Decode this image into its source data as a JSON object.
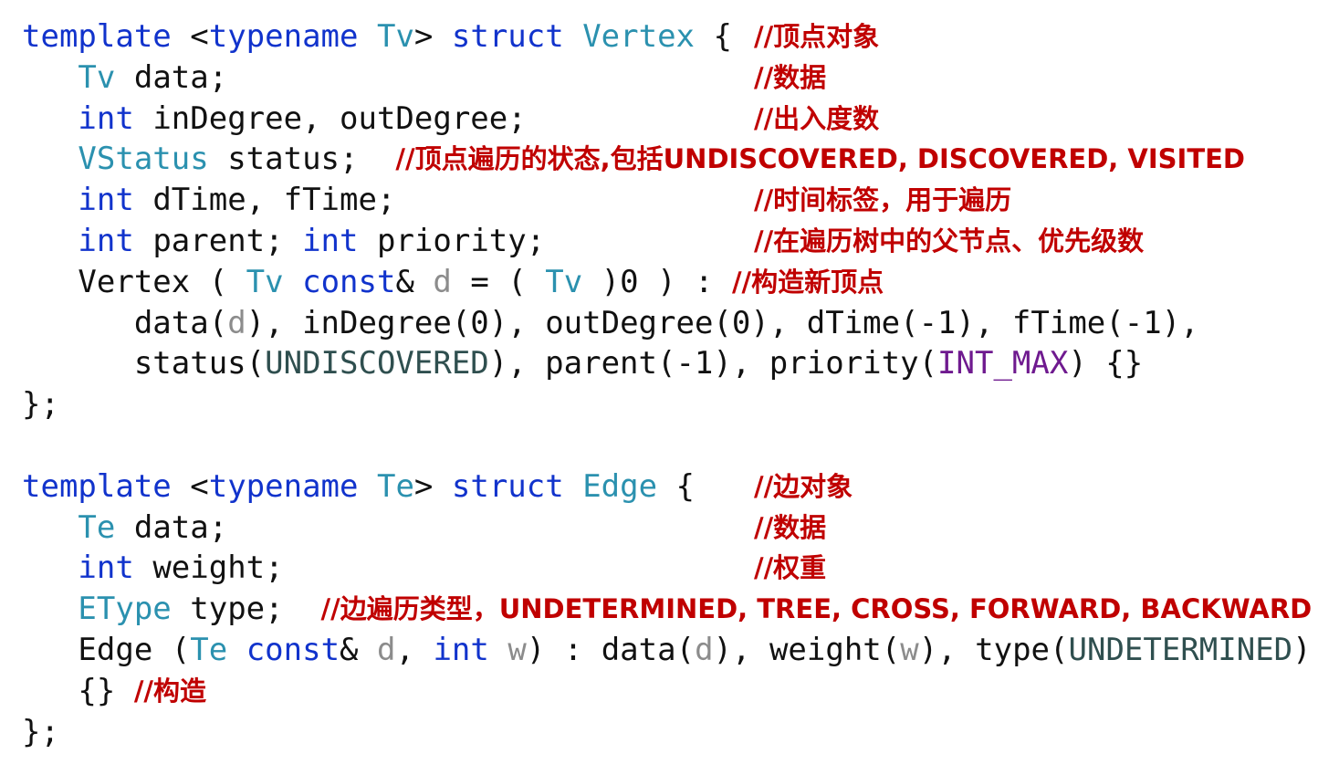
{
  "lines": [
    {
      "indent": 0,
      "tokens": [
        {
          "t": "template",
          "k": "kw"
        },
        {
          "t": " <",
          "k": "tx"
        },
        {
          "t": "typename",
          "k": "kw"
        },
        {
          "t": " ",
          "k": "tx"
        },
        {
          "t": "Tv",
          "k": "ty"
        },
        {
          "t": "> ",
          "k": "tx"
        },
        {
          "t": "struct",
          "k": "kw"
        },
        {
          "t": " ",
          "k": "tx"
        },
        {
          "t": "Vertex",
          "k": "ty"
        },
        {
          "t": " { ",
          "k": "tx"
        }
      ],
      "comment": "//顶点对象",
      "comment_col": "right"
    },
    {
      "indent": 1,
      "tokens": [
        {
          "t": "Tv",
          "k": "ty"
        },
        {
          "t": " data;",
          "k": "tx"
        }
      ],
      "comment": "//数据",
      "comment_col": "right"
    },
    {
      "indent": 1,
      "tokens": [
        {
          "t": "int",
          "k": "kw"
        },
        {
          "t": " inDegree, outDegree;",
          "k": "tx"
        }
      ],
      "comment": "//出入度数",
      "comment_col": "right"
    },
    {
      "indent": 1,
      "tokens": [
        {
          "t": "VStatus",
          "k": "ty"
        },
        {
          "t": " status;  ",
          "k": "tx"
        }
      ],
      "comment": "//顶点遍历的状态,包括UNDISCOVERED, DISCOVERED, VISITED",
      "comment_col": "inline"
    },
    {
      "indent": 1,
      "tokens": [
        {
          "t": "int",
          "k": "kw"
        },
        {
          "t": " dTime, fTime;",
          "k": "tx"
        }
      ],
      "comment": "//时间标签，用于遍历",
      "comment_col": "right"
    },
    {
      "indent": 1,
      "tokens": [
        {
          "t": "int",
          "k": "kw"
        },
        {
          "t": " parent; ",
          "k": "tx"
        },
        {
          "t": "int",
          "k": "kw"
        },
        {
          "t": " priority;",
          "k": "tx"
        }
      ],
      "comment": "//在遍历树中的父节点、优先级数",
      "comment_col": "right"
    },
    {
      "indent": 1,
      "tokens": [
        {
          "t": "Vertex ( ",
          "k": "tx"
        },
        {
          "t": "Tv",
          "k": "ty"
        },
        {
          "t": " ",
          "k": "tx"
        },
        {
          "t": "const",
          "k": "kw"
        },
        {
          "t": "& ",
          "k": "tx"
        },
        {
          "t": "d",
          "k": "pm"
        },
        {
          "t": " = ( ",
          "k": "tx"
        },
        {
          "t": "Tv",
          "k": "ty"
        },
        {
          "t": " )0 ) : ",
          "k": "tx"
        }
      ],
      "comment": "//构造新顶点",
      "comment_col": "inline"
    },
    {
      "indent": 2,
      "tokens": [
        {
          "t": "data(",
          "k": "tx"
        },
        {
          "t": "d",
          "k": "pm"
        },
        {
          "t": "), inDegree(0), outDegree(0), dTime(-1), fTime(-1),",
          "k": "tx"
        }
      ],
      "comment": "",
      "comment_col": "none"
    },
    {
      "indent": 2,
      "tokens": [
        {
          "t": "status(",
          "k": "tx"
        },
        {
          "t": "UNDISCOVERED",
          "k": "en"
        },
        {
          "t": "), parent(-1), priority(",
          "k": "tx"
        },
        {
          "t": "INT_MAX",
          "k": "mc"
        },
        {
          "t": ") {}",
          "k": "tx"
        }
      ],
      "comment": "",
      "comment_col": "none"
    },
    {
      "indent": 0,
      "tokens": [
        {
          "t": "};",
          "k": "tx"
        }
      ],
      "comment": "",
      "comment_col": "none"
    },
    {
      "indent": 0,
      "tokens": [],
      "comment": "",
      "comment_col": "none"
    },
    {
      "indent": 0,
      "tokens": [
        {
          "t": "template",
          "k": "kw"
        },
        {
          "t": " <",
          "k": "tx"
        },
        {
          "t": "typename",
          "k": "kw"
        },
        {
          "t": " ",
          "k": "tx"
        },
        {
          "t": "Te",
          "k": "ty"
        },
        {
          "t": "> ",
          "k": "tx"
        },
        {
          "t": "struct",
          "k": "kw"
        },
        {
          "t": " ",
          "k": "tx"
        },
        {
          "t": "Edge",
          "k": "ty"
        },
        {
          "t": " {",
          "k": "tx"
        }
      ],
      "comment": "//边对象",
      "comment_col": "right"
    },
    {
      "indent": 1,
      "tokens": [
        {
          "t": "Te",
          "k": "ty"
        },
        {
          "t": " data;",
          "k": "tx"
        }
      ],
      "comment": "//数据",
      "comment_col": "right"
    },
    {
      "indent": 1,
      "tokens": [
        {
          "t": "int",
          "k": "kw"
        },
        {
          "t": " weight;",
          "k": "tx"
        }
      ],
      "comment": "//权重",
      "comment_col": "right"
    },
    {
      "indent": 1,
      "tokens": [
        {
          "t": "EType",
          "k": "ty"
        },
        {
          "t": " type;  ",
          "k": "tx"
        }
      ],
      "comment": "//边遍历类型，UNDETERMINED, TREE, CROSS, FORWARD, BACKWARD",
      "comment_col": "inline"
    },
    {
      "indent": 1,
      "tokens": [
        {
          "t": "Edge (",
          "k": "tx"
        },
        {
          "t": "Te",
          "k": "ty"
        },
        {
          "t": " ",
          "k": "tx"
        },
        {
          "t": "const",
          "k": "kw"
        },
        {
          "t": "& ",
          "k": "tx"
        },
        {
          "t": "d",
          "k": "pm"
        },
        {
          "t": ", ",
          "k": "tx"
        },
        {
          "t": "int",
          "k": "kw"
        },
        {
          "t": " ",
          "k": "tx"
        },
        {
          "t": "w",
          "k": "pm"
        },
        {
          "t": ") : data(",
          "k": "tx"
        },
        {
          "t": "d",
          "k": "pm"
        },
        {
          "t": "), weight(",
          "k": "tx"
        },
        {
          "t": "w",
          "k": "pm"
        },
        {
          "t": "), type(",
          "k": "tx"
        },
        {
          "t": "UNDETERMINED",
          "k": "en"
        },
        {
          "t": ")",
          "k": "tx"
        }
      ],
      "comment": "",
      "comment_col": "none"
    },
    {
      "indent": 1,
      "tokens": [
        {
          "t": "{} ",
          "k": "tx"
        }
      ],
      "comment": "//构造",
      "comment_col": "inline"
    },
    {
      "indent": 0,
      "tokens": [
        {
          "t": "};",
          "k": "tx"
        }
      ],
      "comment": "",
      "comment_col": "none"
    }
  ]
}
